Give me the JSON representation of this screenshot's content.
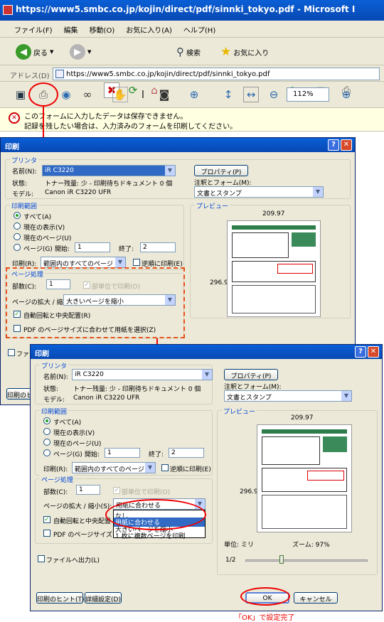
{
  "browser": {
    "title": "https://www5.smbc.co.jp/kojin/direct/pdf/sinnki_tokyo.pdf - Microsoft I",
    "menu": [
      "ファイル(F)",
      "編集",
      "移動(O)",
      "お気に入り(A)",
      "ヘルプ(H)"
    ],
    "back_label": "戻る",
    "search_label": "検索",
    "favorites_label": "お気に入り",
    "address_label": "アドレス(D)",
    "address_url": "https://www5.smbc.co.jp/kojin/direct/pdf/sinnki_tokyo.pdf",
    "zoom": "112%",
    "info_line1": "このフォームに入力したデータは保存できません。",
    "info_line2": "記録を残したい場合は、入力済みのフォームを印刷してください。"
  },
  "dialog1": {
    "title": "印刷",
    "printer_group": "プリンタ",
    "name_label": "名前(N):",
    "name_value": "iR C3220",
    "properties_button": "プロパティ(P)",
    "status_label": "状態:",
    "status_value": "トナー残量: 少 - 印刷待ちドキュメント 0 個",
    "model_label": "モデル:",
    "model_value": "Canon iR C3220 UFR",
    "comments_label": "注釈とフォーム(M):",
    "comments_value": "文書とスタンプ",
    "range_group": "印刷範囲",
    "range_all": "すべて(A)",
    "range_view": "現在の表示(V)",
    "range_page": "現在のページ(U)",
    "range_pages": "ページ(G)",
    "start_label": "開始:",
    "start_value": "1",
    "end_label": "終了:",
    "end_value": "2",
    "print_label": "印刷(R):",
    "print_value": "範囲内のすべてのページ",
    "reverse_label": "逆順に印刷(E)",
    "handling_group": "ページ処理",
    "copies_label": "部数(C):",
    "copies_value": "1",
    "collate_label": "部単位で印刷(O)",
    "scaling_label": "ページの拡大 / 縮小(S):",
    "scaling_value": "大きいページを縮小",
    "autorotate_label": "自動回転と中央配置(R)",
    "paper_by_pdf_label": "PDF のページサイズに合わせて用紙を選択(Z)",
    "print_to_file_short": "ファイ",
    "hint_short": "印刷のヒ",
    "preview_group": "プレビュー",
    "width_value": "209.97",
    "height_value": "296.93"
  },
  "dialog2": {
    "title": "印刷",
    "printer_group": "プリンタ",
    "name_label": "名前(N):",
    "name_value": "iR C3220",
    "properties_button": "プロパティ(P)",
    "status_label": "状態:",
    "status_value": "トナー残量: 少 - 印刷待ちドキュメント 0 個",
    "model_label": "モデル:",
    "model_value": "Canon iR C3220 UFR",
    "comments_label": "注釈とフォーム(M):",
    "comments_value": "文書とスタンプ",
    "range_group": "印刷範囲",
    "range_all": "すべて(A)",
    "range_view": "現在の表示(V)",
    "range_page": "現在のページ(U)",
    "range_pages": "ページ(G)",
    "start_label": "開始:",
    "start_value": "1",
    "end_label": "終了:",
    "end_value": "2",
    "print_label": "印刷(R):",
    "print_value": "範囲内のすべてのページ",
    "reverse_label": "逆順に印刷(E)",
    "handling_group": "ページ処理",
    "copies_label": "部数(C):",
    "copies_value": "1",
    "collate_label": "部単位で印刷(O)",
    "scaling_label": "ページの拡大 / 縮小(S):",
    "scaling_value": "用紙に合わせる",
    "scaling_options": [
      "なし",
      "用紙に合わせる",
      "大きいページを縮小",
      "1 枚に複数ページを印刷"
    ],
    "autorotate_label": "自動回転と中央配置",
    "paper_by_pdf_label": "PDF のページサイズに合",
    "print_to_file_label": "ファイルへ出力(L)",
    "preview_group": "プレビュー",
    "width_value": "209.97",
    "height_value": "296.93",
    "unit_label": "単位: ミリ",
    "zoom_label": "ズーム:  97%",
    "page_counter": "1/2",
    "hint_button": "印刷のヒント(T)",
    "advanced_button": "詳細設定(D)",
    "ok_button": "OK",
    "cancel_button": "キャンセル"
  },
  "annotation": "「OK」で設定完了",
  "colors": {
    "accent_red": "#e00000",
    "dashed_orange": "#e8501a",
    "title_blue": "#0a5fd6",
    "annotation_red": "#e00000"
  }
}
